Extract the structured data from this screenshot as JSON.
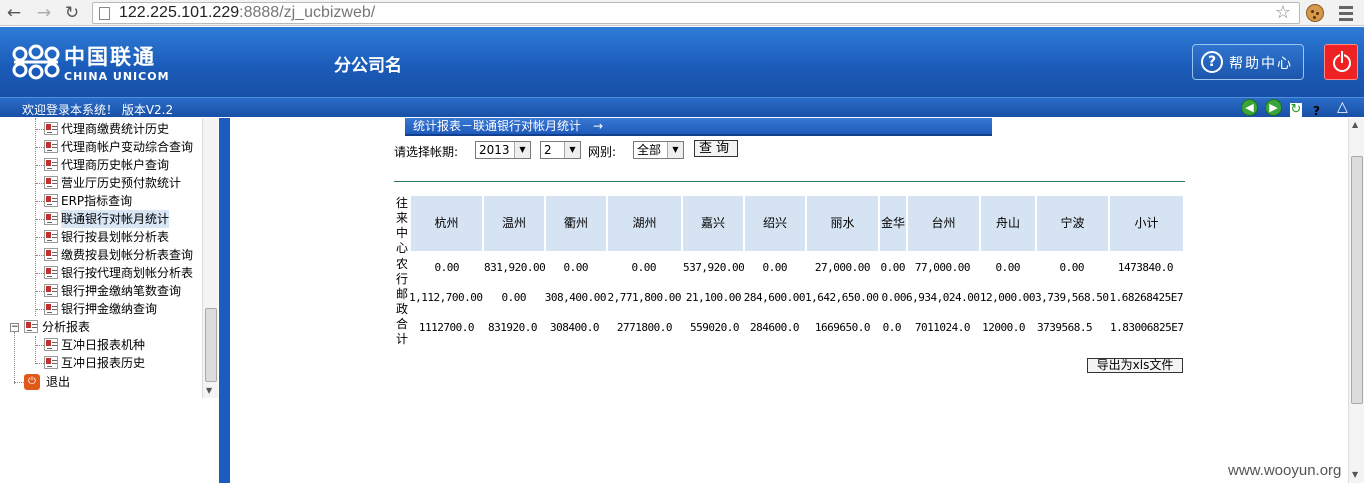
{
  "browser": {
    "url_host": "122.225.101.229",
    "url_rest": ":8888/zj_ucbizweb/"
  },
  "header": {
    "logo_cn": "中国联通",
    "logo_en": "CHINA UNICOM",
    "company": "分公司名",
    "help_label": "帮助中心"
  },
  "status": {
    "welcome": "欢迎登录本系统！ 版本V2.2",
    "qmark": "?"
  },
  "sidebar": {
    "items": [
      {
        "label": "代理商缴费统计历史"
      },
      {
        "label": "代理商帐户变动综合查询"
      },
      {
        "label": "代理商历史帐户查询"
      },
      {
        "label": "营业厅历史预付款统计"
      },
      {
        "label": "ERP指标查询"
      },
      {
        "label": "联通银行对帐月统计"
      },
      {
        "label": "银行按县划帐分析表"
      },
      {
        "label": "缴费按县划帐分析表查询"
      },
      {
        "label": "银行按代理商划帐分析表"
      },
      {
        "label": "银行押金缴纳笔数查询"
      },
      {
        "label": "银行押金缴纳查询"
      }
    ],
    "group": "分析报表",
    "group_items": [
      {
        "label": "互冲日报表机种"
      },
      {
        "label": "互冲日报表历史"
      }
    ],
    "exit": "退出"
  },
  "main": {
    "breadcrumb": "统计报表－联通银行对帐月统计　→",
    "query": {
      "period_label": "请选择帐期:",
      "year": "2013",
      "month": "2",
      "network_label": "网别:",
      "network": "全部",
      "search_btn": "查询"
    },
    "table": {
      "corner_label": "往来中心",
      "columns": [
        "杭州",
        "温州",
        "衢州",
        "湖州",
        "嘉兴",
        "绍兴",
        "丽水",
        "金华",
        "台州",
        "舟山",
        "宁波",
        "小计"
      ],
      "rows": [
        {
          "label": "农行",
          "values": [
            "0.00",
            "831,920.00",
            "0.00",
            "0.00",
            "537,920.00",
            "0.00",
            "27,000.00",
            "0.00",
            "77,000.00",
            "0.00",
            "0.00",
            "1473840.0"
          ]
        },
        {
          "label": "邮政",
          "values": [
            "1,112,700.00",
            "0.00",
            "308,400.00",
            "2,771,800.00",
            "21,100.00",
            "284,600.00",
            "1,642,650.00",
            "0.00",
            "6,934,024.00",
            "12,000.00",
            "3,739,568.50",
            "1.68268425E7"
          ]
        },
        {
          "label": "合计",
          "values": [
            "1112700.0",
            "831920.0",
            "308400.0",
            "2771800.0",
            "559020.0",
            "284600.0",
            "1669650.0",
            "0.0",
            "7011024.0",
            "12000.0",
            "3739568.5",
            "1.83006825E7"
          ]
        }
      ]
    },
    "export_btn": "导出为xls文件"
  },
  "watermark": "www.wooyun.org",
  "colors": {
    "header_blue": "#1a5ab8",
    "table_header_bg": "#d6e3f2",
    "power_red": "#e22222"
  }
}
